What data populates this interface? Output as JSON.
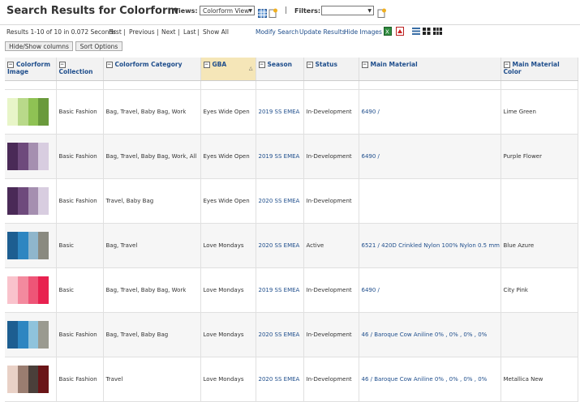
{
  "header": {
    "title": "Search Results for Colorform",
    "views_label": "Views:",
    "views_value": "Colorform View",
    "separator": "|",
    "filters_label": "Filters:",
    "filters_value": ""
  },
  "nav": {
    "results": "Results 1-10 of 10 in 0.072 Seconds",
    "first": "First",
    "previous": "Previous",
    "next": "Next",
    "last": "Last",
    "show_all": "Show All",
    "pipe": "|",
    "modify_search": "Modify Search",
    "update_results": "Update Results",
    "hide_images": "Hide Images"
  },
  "buttons": {
    "hide_show_columns": "Hide/Show columns",
    "sort_options": "Sort Options"
  },
  "columns": {
    "image": "Colorform Image",
    "collection": "Collection",
    "category": "Colorform Category",
    "gba": "GBA",
    "season": "Season",
    "status": "Status",
    "material": "Main Material",
    "material_color": "Main Material Color",
    "collapse_glyph": "−"
  },
  "rows": [
    {
      "swatches": [
        "#e8f5c8",
        "#b9d98a",
        "#8fc254",
        "#6a9a3c"
      ],
      "collection": "Basic Fashion",
      "category": "Bag, Travel, Baby Bag, Work",
      "gba": "Eyes Wide Open",
      "season": "2019 SS EMEA",
      "status": "In-Development",
      "material": "6490 /",
      "material_color": "Lime Green"
    },
    {
      "swatches": [
        "#4a2a57",
        "#6e4a7c",
        "#a58fb0",
        "#d8cde0"
      ],
      "collection": "Basic Fashion",
      "category": "Bag, Travel, Baby Bag, Work, All",
      "gba": "Eyes Wide Open",
      "season": "2019 SS EMEA",
      "status": "In-Development",
      "material": "6490 /",
      "material_color": "Purple Flower"
    },
    {
      "swatches": [
        "#4a2a57",
        "#6e4a7c",
        "#a58fb0",
        "#d8cde0"
      ],
      "collection": "Basic Fashion",
      "category": "Travel, Baby Bag",
      "gba": "Eyes Wide Open",
      "season": "2020 SS EMEA",
      "status": "In-Development",
      "material": "",
      "material_color": ""
    },
    {
      "swatches": [
        "#1d5e91",
        "#2e86c1",
        "#8fb6cc",
        "#8a8a80"
      ],
      "collection": "Basic",
      "category": "Bag, Travel",
      "gba": "Love Mondays",
      "season": "2020 SS EMEA",
      "status": "Active",
      "material": "6521 / 420D Crinkled Nylon 100% Nylon 0.5 mm",
      "material_color": "Blue Azure"
    },
    {
      "swatches": [
        "#f9c3cc",
        "#f38a9e",
        "#ee5577",
        "#e8214f"
      ],
      "collection": "Basic",
      "category": "Bag, Travel, Baby Bag, Work",
      "gba": "Love Mondays",
      "season": "2019 SS EMEA",
      "status": "In-Development",
      "material": "6490 /",
      "material_color": "City Pink"
    },
    {
      "swatches": [
        "#1d5e91",
        "#2e86c1",
        "#8fc3dc",
        "#9a9a90"
      ],
      "collection": "Basic Fashion",
      "category": "Bag, Travel, Baby Bag",
      "gba": "Love Mondays",
      "season": "2020 SS EMEA",
      "status": "In-Development",
      "material": "46 / Baroque   Cow Aniline 0% , 0% , 0% , 0%",
      "material_color": ""
    },
    {
      "swatches": [
        "#e9d1c6",
        "#9a7d70",
        "#4a3f3a",
        "#6a1518"
      ],
      "collection": "Basic Fashion",
      "category": "Travel",
      "gba": "Love Mondays",
      "season": "2020 SS EMEA",
      "status": "In-Development",
      "material": "46 / Baroque   Cow Aniline 0% , 0% , 0% , 0%",
      "material_color": "Metallica New"
    }
  ]
}
